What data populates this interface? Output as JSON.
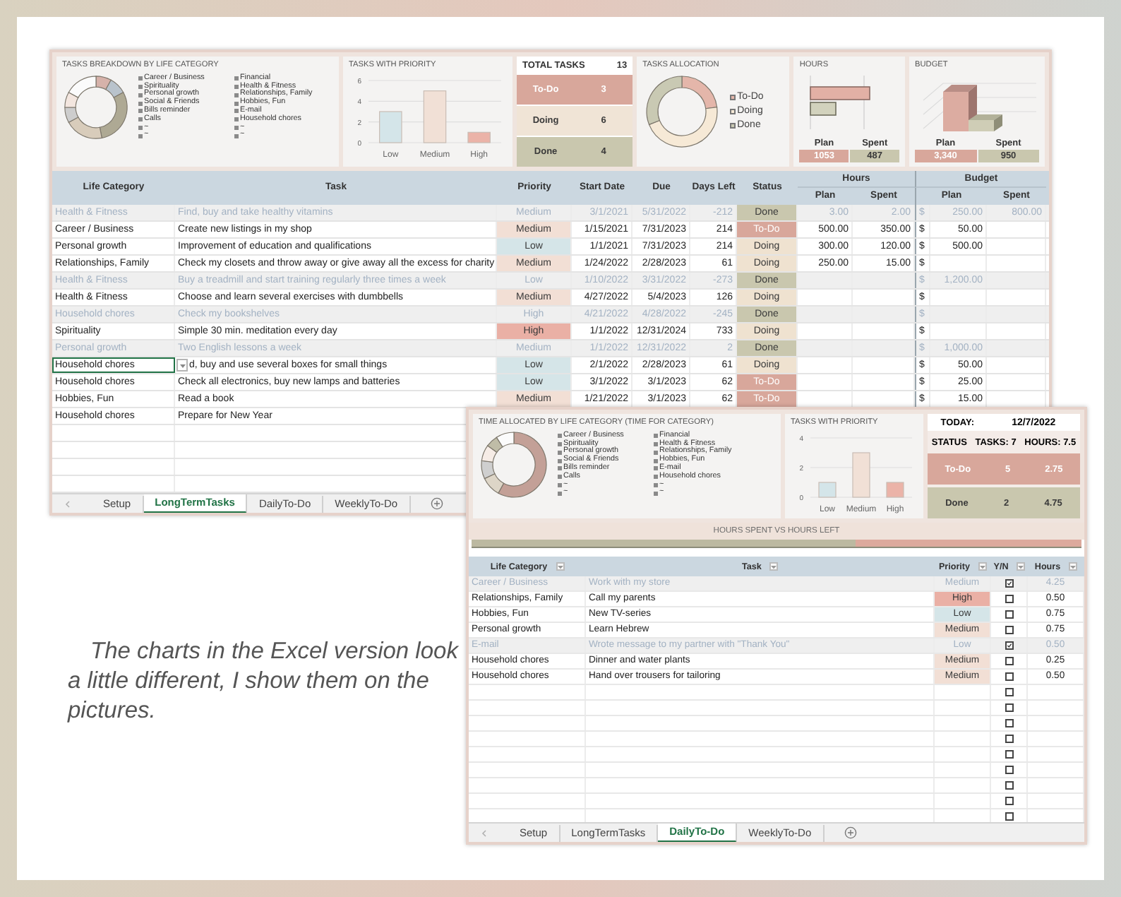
{
  "caption": "The charts in the Excel version look a little different, I show them on the pictures.",
  "long_term_window": {
    "dashboard": {
      "breakdown": {
        "title": "TASKS BREAKDOWN BY LIFE CATEGORY",
        "legend": [
          "Career / Business",
          "Spirituality",
          "Personal growth",
          "Social & Friends",
          "Bills reminder",
          "Calls",
          "~",
          "~",
          "Financial",
          "Health & Fitness",
          "Relationships, Family",
          "Hobbies, Fun",
          "E-mail",
          "Household chores",
          "~",
          "~"
        ]
      },
      "priority_chart": {
        "title": "TASKS WITH PRIORITY",
        "chart_data": {
          "type": "bar",
          "categories": [
            "Low",
            "Medium",
            "High"
          ],
          "ylim": [
            0,
            6
          ],
          "yticks": [
            0,
            2,
            4,
            6
          ],
          "values": [
            3,
            5,
            1
          ],
          "colors": [
            "#d4e5e9",
            "#f1e0d6",
            "#ebb3a8"
          ]
        }
      },
      "totals": {
        "title": "TOTAL TASKS",
        "total": "13",
        "statuses": [
          {
            "label": "To-Do",
            "count": "3",
            "color": "#d8a79b"
          },
          {
            "label": "Doing",
            "count": "6",
            "color": "#f0e4d6"
          },
          {
            "label": "Done",
            "count": "4",
            "color": "#c9c7ae"
          }
        ]
      },
      "allocation": {
        "title": "TASKS ALLOCATION",
        "legend": [
          {
            "label": "To-Do",
            "color": "#e4b6aa"
          },
          {
            "label": "Doing",
            "color": "#f6e9d6"
          },
          {
            "label": "Done",
            "color": "#c9c9b3"
          }
        ]
      },
      "hours": {
        "title": "HOURS",
        "columns": [
          {
            "label": "Plan",
            "value": "1053",
            "color": "#d8a79b"
          },
          {
            "label": "Spent",
            "value": "487",
            "color": "#c9c7ae"
          }
        ]
      },
      "budget": {
        "title": "BUDGET",
        "columns": [
          {
            "label": "Plan",
            "value": "3,340",
            "color": "#d8a79b"
          },
          {
            "label": "Spent",
            "value": "950",
            "color": "#c9c7ae"
          }
        ]
      }
    },
    "table": {
      "columns": [
        "Life Category",
        "Task",
        "Priority",
        "Start Date",
        "Due",
        "Days Left",
        "Status"
      ],
      "groups": [
        {
          "label": "Hours",
          "columns": [
            "Plan",
            "Spent"
          ]
        },
        {
          "label": "Budget",
          "columns": [
            "Plan",
            "Spent"
          ]
        }
      ],
      "rows": [
        {
          "completed": true,
          "selected": false,
          "category": "Health & Fitness",
          "task": "Find, buy and take healthy vitamins",
          "priority": {
            "text": "Medium"
          },
          "start": "3/1/2021",
          "due": "5/31/2022",
          "days_left": "-212",
          "status": {
            "text": "Done",
            "color": "#c9c7ae"
          },
          "hours_plan": "3.00",
          "hours_spent": "2.00",
          "currency": "$",
          "budget_plan": "250.00",
          "budget_spent": "800.00"
        },
        {
          "completed": false,
          "selected": false,
          "category": "Career / Business",
          "task": "Create new listings in my shop",
          "priority": {
            "text": "Medium",
            "color": "#f2dfd5"
          },
          "start": "1/15/2021",
          "due": "7/31/2023",
          "days_left": "214",
          "status": {
            "text": "To-Do",
            "color": "#d8a79b"
          },
          "hours_plan": "500.00",
          "hours_spent": "350.00",
          "currency": "$",
          "budget_plan": "50.00"
        },
        {
          "completed": false,
          "selected": false,
          "category": "Personal growth",
          "task": "Improvement of education and qualifications",
          "priority": {
            "text": "Low",
            "color": "#d5e5e8"
          },
          "start": "1/1/2021",
          "due": "7/31/2023",
          "days_left": "214",
          "status": {
            "text": "Doing",
            "color": "#efe2d0"
          },
          "hours_plan": "300.00",
          "hours_spent": "120.00",
          "currency": "$",
          "budget_plan": "500.00"
        },
        {
          "completed": false,
          "selected": false,
          "category": "Relationships, Family",
          "task": "Check my closets and throw away or give away all the excess for charity",
          "priority": {
            "text": "Medium",
            "color": "#f2dfd5"
          },
          "start": "1/24/2022",
          "due": "2/28/2023",
          "days_left": "61",
          "status": {
            "text": "Doing",
            "color": "#efe2d0"
          },
          "hours_plan": "250.00",
          "hours_spent": "15.00",
          "currency": "$"
        },
        {
          "completed": true,
          "selected": false,
          "category": "Health & Fitness",
          "task": "Buy a treadmill and start training regularly three times a week",
          "priority": {
            "text": "Low"
          },
          "start": "1/10/2022",
          "due": "3/31/2022",
          "days_left": "-273",
          "status": {
            "text": "Done",
            "color": "#c9c7ae"
          },
          "currency": "$",
          "budget_plan": "1,200.00"
        },
        {
          "completed": false,
          "selected": false,
          "category": "Health & Fitness",
          "task": "Choose and learn several exercises with dumbbells",
          "priority": {
            "text": "Medium",
            "color": "#f2dfd5"
          },
          "start": "4/27/2022",
          "due": "5/4/2023",
          "days_left": "126",
          "status": {
            "text": "Doing",
            "color": "#efe2d0"
          },
          "currency": "$"
        },
        {
          "completed": true,
          "selected": false,
          "category": "Household chores",
          "task": "Check my bookshelves",
          "priority": {
            "text": "High"
          },
          "start": "4/21/2022",
          "due": "4/28/2022",
          "days_left": "-245",
          "status": {
            "text": "Done",
            "color": "#c9c7ae"
          },
          "currency": "$"
        },
        {
          "completed": false,
          "selected": false,
          "category": "Spirituality",
          "task": "Simple 30 min. meditation every day",
          "priority": {
            "text": "High",
            "color": "#eab0a5"
          },
          "start": "1/1/2022",
          "due": "12/31/2024",
          "days_left": "733",
          "status": {
            "text": "Doing",
            "color": "#efe2d0"
          },
          "currency": "$"
        },
        {
          "completed": true,
          "selected": false,
          "category": "Personal growth",
          "task": "Two English lessons a week",
          "priority": {
            "text": "Medium"
          },
          "start": "1/1/2022",
          "due": "12/31/2022",
          "days_left": "2",
          "status": {
            "text": "Done",
            "color": "#c9c7ae"
          },
          "currency": "$",
          "budget_plan": "1,000.00"
        },
        {
          "completed": false,
          "selected": true,
          "category": "Household chores",
          "task": "d, buy and use several boxes for small things",
          "priority": {
            "text": "Low",
            "color": "#d5e5e8"
          },
          "start": "2/1/2022",
          "due": "2/28/2023",
          "days_left": "61",
          "status": {
            "text": "Doing",
            "color": "#efe2d0"
          },
          "currency": "$",
          "budget_plan": "50.00"
        },
        {
          "completed": false,
          "selected": false,
          "category": "Household chores",
          "task": "Check all electronics, buy new lamps and batteries",
          "priority": {
            "text": "Low",
            "color": "#d5e5e8"
          },
          "start": "3/1/2022",
          "due": "3/1/2023",
          "days_left": "62",
          "status": {
            "text": "To-Do",
            "color": "#d8a79b"
          },
          "currency": "$",
          "budget_plan": "25.00"
        },
        {
          "completed": false,
          "selected": false,
          "category": "Hobbies, Fun",
          "task": "Read a book",
          "priority": {
            "text": "Medium",
            "color": "#f2dfd5"
          },
          "start": "1/21/2022",
          "due": "3/1/2023",
          "days_left": "62",
          "status": {
            "text": "To-Do",
            "color": "#d8a79b"
          },
          "currency": "$",
          "budget_plan": "15.00"
        },
        {
          "completed": false,
          "selected": false,
          "category": "Household chores",
          "task": "Prepare for New Year"
        }
      ]
    },
    "sheet_tabs": [
      {
        "label": "Setup",
        "selected": false
      },
      {
        "label": "LongTermTasks",
        "selected": true
      },
      {
        "label": "DailyTo-Do",
        "selected": false
      },
      {
        "label": "WeeklyTo-Do",
        "selected": false
      }
    ]
  },
  "daily_window": {
    "dashboard": {
      "time_allocation": {
        "title": "TIME ALLOCATED BY LIFE CATEGORY (TIME FOR CATEGORY)",
        "legend": [
          "Career / Business",
          "Spirituality",
          "Personal growth",
          "Social & Friends",
          "Bills reminder",
          "Calls",
          "~",
          "~",
          "Financial",
          "Health & Fitness",
          "Relationships, Family",
          "Hobbies, Fun",
          "E-mail",
          "Household chores",
          "~",
          "~"
        ]
      },
      "priority_chart": {
        "title": "TASKS WITH PRIORITY",
        "chart_data": {
          "type": "bar",
          "categories": [
            "Low",
            "Medium",
            "High"
          ],
          "ylim": [
            0,
            4
          ],
          "yticks": [
            0,
            2,
            4
          ],
          "values": [
            1,
            3,
            1
          ],
          "colors": [
            "#d4e5e9",
            "#f1e0d6",
            "#ebb3a8"
          ]
        }
      },
      "status": {
        "today_label": "TODAY:",
        "today": "12/7/2022",
        "header": [
          "STATUS",
          "TASKS: 7",
          "HOURS: 7.5"
        ],
        "rows": [
          {
            "label": "To-Do",
            "tasks": "5",
            "hours": "2.75",
            "color": "#d8a79b"
          },
          {
            "label": "Done",
            "tasks": "2",
            "hours": "4.75",
            "color": "#c9c7ae"
          }
        ]
      }
    },
    "hours_bar": {
      "title": "HOURS SPENT VS HOURS LEFT",
      "level": 0.63
    },
    "table": {
      "columns": [
        "Life Category",
        "Task",
        "Priority",
        "Y/N",
        "Hours"
      ],
      "rows": [
        {
          "checked": true,
          "category": "Career / Business",
          "task": "Work with my store",
          "priority": {
            "text": "Medium"
          },
          "hours": "4.25"
        },
        {
          "checked": false,
          "category": "Relationships, Family",
          "task": "Call my parents",
          "priority": {
            "text": "High",
            "color": "#eab0a5"
          },
          "hours": "0.50"
        },
        {
          "checked": false,
          "category": "Hobbies, Fun",
          "task": "New TV-series",
          "priority": {
            "text": "Low",
            "color": "#d5e5e8"
          },
          "hours": "0.75"
        },
        {
          "checked": false,
          "category": "Personal growth",
          "task": "Learn Hebrew",
          "priority": {
            "text": "Medium",
            "color": "#f2dfd5"
          },
          "hours": "0.75"
        },
        {
          "checked": true,
          "category": "E-mail",
          "task": "Wrote message to my partner with \"Thank You\"",
          "priority": {
            "text": "Low"
          },
          "hours": "0.50"
        },
        {
          "checked": false,
          "category": "Household chores",
          "task": "Dinner and water plants",
          "priority": {
            "text": "Medium",
            "color": "#f2dfd5"
          },
          "hours": "0.25"
        },
        {
          "checked": false,
          "category": "Household chores",
          "task": "Hand over trousers for tailoring",
          "priority": {
            "text": "Medium",
            "color": "#f2dfd5"
          },
          "hours": "0.50"
        },
        {
          "checked": false
        },
        {
          "checked": false
        },
        {
          "checked": false
        },
        {
          "checked": false
        },
        {
          "checked": false
        },
        {
          "checked": false
        },
        {
          "checked": false
        },
        {
          "checked": false
        },
        {
          "checked": false
        }
      ]
    },
    "sheet_tabs": [
      {
        "label": "Setup",
        "selected": false
      },
      {
        "label": "LongTermTasks",
        "selected": false
      },
      {
        "label": "DailyTo-Do",
        "selected": true
      },
      {
        "label": "WeeklyTo-Do",
        "selected": false
      }
    ]
  }
}
